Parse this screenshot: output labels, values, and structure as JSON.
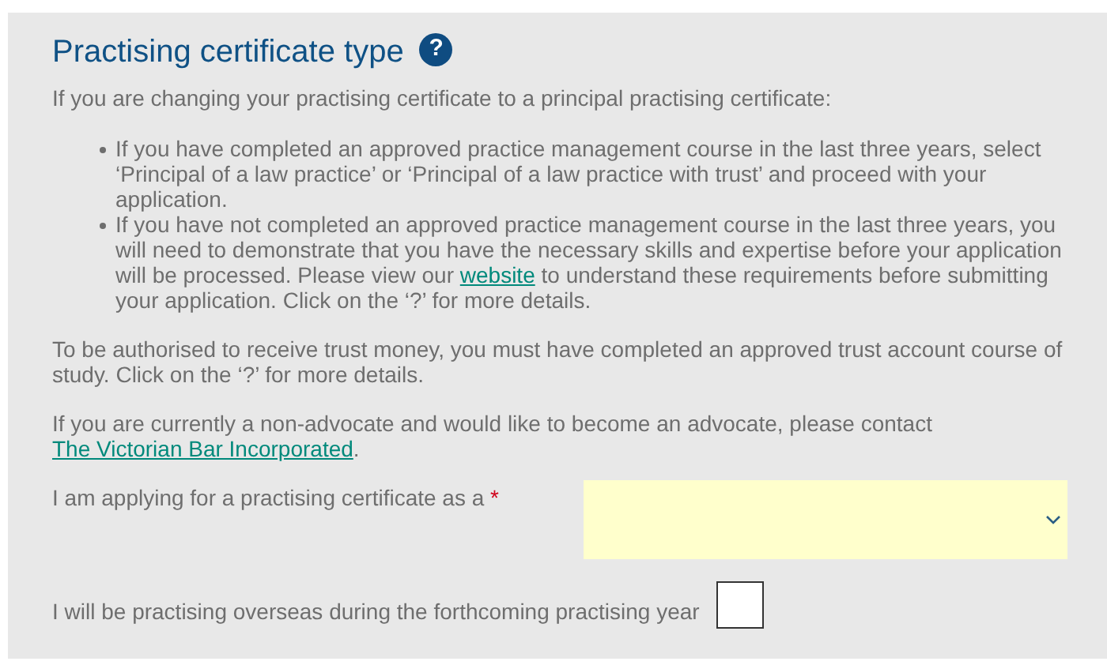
{
  "section": {
    "title": "Practising certificate type",
    "help_icon": "?"
  },
  "intro": "If you are changing your practising certificate to a principal practising certificate:",
  "bullets": [
    [
      {
        "kind": "text",
        "text": "If you have completed an approved practice management course in the last three years, select ‘Principal of a law practice’ or ‘Principal of a law practice with trust’ and proceed with your application."
      }
    ],
    [
      {
        "kind": "text",
        "text": "If you have not completed an approved practice management course in the last three years, you will need to demonstrate that you have the necessary skills and expertise before your application will be processed. Please view our "
      },
      {
        "kind": "link",
        "text": "website"
      },
      {
        "kind": "text",
        "text": " to understand these requirements before submitting your application. Click on the ‘?’ for more details."
      }
    ]
  ],
  "paragraphs": [
    [
      {
        "kind": "text",
        "text": "To be authorised to receive trust money, you must have completed an approved trust account course of study. Click on the ‘?’ for more details."
      }
    ],
    [
      {
        "kind": "text",
        "text": "If you are currently a non-advocate and would like to become an advocate, please contact "
      },
      {
        "kind": "link",
        "text": "The Victorian Bar Incorporated"
      },
      {
        "kind": "text",
        "text": "."
      }
    ]
  ],
  "certificate_select": {
    "label": "I am applying for a practising certificate as a",
    "required": true,
    "required_mark": "*"
  },
  "overseas_checkbox": {
    "label": "I will be practising overseas during the forthcoming practising year",
    "checked": false
  }
}
